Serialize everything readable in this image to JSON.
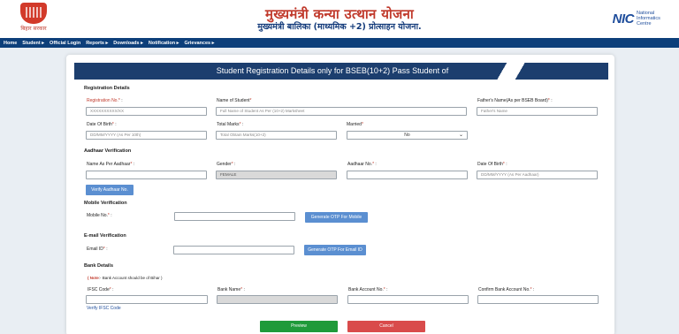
{
  "header": {
    "title": "मुख्यमंत्री कन्या उत्थान योजना",
    "subtitle": "मुख्यमंत्री बालिका (माध्यमिक +2) प्रोत्साहन योजना.",
    "logo_caption": "बिहार सरकार",
    "nic_mark": "NIC",
    "nic_text": "National Informatics Centre"
  },
  "nav": {
    "items": [
      "Home",
      "Student ▸",
      "Official Login",
      "Reports ▸",
      "Downloads ▸",
      "Notification ▸",
      "Grievances ▸"
    ]
  },
  "form": {
    "banner": "Student Registration Details only for BSEB(10+2) Pass Student of",
    "sections": {
      "registration": "Registration Details",
      "aadhaar": "Aadhaar Verification",
      "mobile": "Mobile Verification",
      "email": "E-mail Verification",
      "bank": "Bank Details"
    },
    "fields": {
      "reg_no": {
        "label": "Registration No.",
        "placeholder": "XXXXXXXXXX/XX"
      },
      "student_name": {
        "label": "Name of Student",
        "placeholder": "Full Name of Student As Per (10+2) Marksheet"
      },
      "father_name": {
        "label": "Father's Name(As per BSEB Board)",
        "placeholder": "Father's Name"
      },
      "dob": {
        "label": "Date Of Birth",
        "placeholder": "DD/MM/YYYY (As Per 10th)"
      },
      "total_marks": {
        "label": "Total Marks",
        "placeholder": "Total Obtain Marks(10+2)"
      },
      "married": {
        "label": "Married",
        "value": "No"
      },
      "aadhaar_name": {
        "label": "Name As Per Aadhaar",
        "placeholder": ""
      },
      "gender": {
        "label": "Gender",
        "value": "FEMALE"
      },
      "aadhaar_no": {
        "label": "Aadhaar No.",
        "placeholder": ""
      },
      "aadhaar_dob": {
        "label": "Date Of Birth",
        "placeholder": "DD/MM/YYYY (As Per Aadhaar)"
      },
      "mobile": {
        "label": "Mobile No.",
        "placeholder": ""
      },
      "email": {
        "label": "Email ID",
        "placeholder": ""
      },
      "ifsc": {
        "label": "IFSC Code",
        "placeholder": ""
      },
      "bank_name": {
        "label": "Bank Name",
        "placeholder": ""
      },
      "account_no": {
        "label": "Bank Account No.",
        "placeholder": ""
      },
      "confirm_account_no": {
        "label": "Confirm Bank Account No.",
        "placeholder": ""
      }
    },
    "required_mark": "*",
    "colon": " :",
    "bank_note": {
      "tag": "( Note",
      "text": ":- Bank Account should be of Bihar )"
    },
    "buttons": {
      "verify_aadhaar": "Verify Aadhaar No.",
      "otp_mobile": "Generate OTP For Mobile",
      "otp_email": "Generate OTP For Email ID",
      "verify_ifsc": "Verify IFSC Code",
      "preview": "Preview",
      "cancel": "Cancel"
    }
  },
  "colors": {
    "nav_bg": "#0d3f7a",
    "banner_bg": "#1c3e6e",
    "title_red": "#c0392b",
    "button_blue": "#5b8fd1",
    "preview_green": "#1f9a3a",
    "cancel_red": "#d94b4b"
  }
}
